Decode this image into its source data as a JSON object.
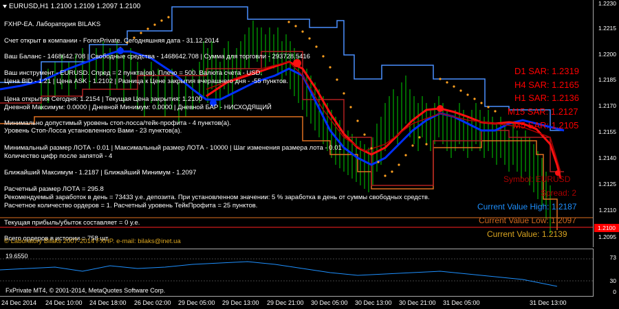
{
  "chart": {
    "header": "EURUSD,H1  1.2100 1.2109 1.2097 1.2100",
    "price_labels": [
      "1.2230",
      "1.2215",
      "1.2200",
      "1.2185",
      "1.2170",
      "1.2155",
      "1.2140",
      "1.2125",
      "1.2110",
      "1.2095"
    ],
    "current_price_box": "1.2100",
    "time_labels": [
      "24 Dec 2014",
      "24 Dec 10:00",
      "24 Dec 18:00",
      "26 Dec 02:00",
      "29 Dec 05:00",
      "29 Dec 13:00",
      "29 Dec 21:00",
      "30 Dec 05:00",
      "30 Dec 13:00",
      "30 Dec 21:00",
      "31 Dec 05:00",
      "31 Dec 13:00"
    ]
  },
  "info_lines": [
    "FXHP-EA. Лаборатория BILAKS",
    "Счет открыт в компании - ForexPrivate.    Сегодняшняя дата  -  31.12.2014",
    "Ваш Баланс - 1468642.708  |  Свободные средства - 1468642.708  |  Сумма для торговли - 293728.5416",
    "Ваш инструмент - EURUSD. Спред = 2 пункта(ов). Плечо = 500. Валюта счета - USD.",
    "Цена BID - 1.21  |  Цена ASK - 1.2102  |  Разница к Цене закрытия вчерашнего дня - -55 пунктов.",
    "Цена открытия Сегодня:  1.2154  |  Текущая Цена закрытия:  1.2100",
    "Дневной Максимум: 0.0000  |  Дневной Минимум: 0.0000  |  Дневной БАР - НИСХОДЯЩИЙ",
    "Минимально допустимый уровень стоп-лосса/тейк-профита - 4 пунктов(а).",
    "Уровень Стоп-Лосса установленного Вами - 23 пунктов(а).",
    "Минимальный размер ЛОТА - 0.01  |  Максимальный размер ЛОТА - 10000  |  Шаг изменения размера лота - 0.01",
    "Количество цифр после запятой - 4",
    "Ближайший Максимум - 1.2187  |  Ближайший Минимум - 1.2097",
    "Расчетный размер ЛОТА = 295.8",
    "Рекомендуемый заработок в день = 73433 у.е. депозита. При установленном значении: 5 % заработка в день от суммы свободных средств.",
    "Расчетное количество ордеров = 1. Расчетный уровень ТейкПрофита = 25 пунктов.",
    "Текущая прибыль/убыток составляет = 0 у.е.",
    "Всего ордеров в истории = 758 шт.",
    "© Laboratory Bilaks 2007-2014 FXHP. e-mail: bilaks@inet.ua"
  ],
  "sar": {
    "d1": "D1 SAR: 1.2319",
    "h4": "H4 SAR: 1.2165",
    "h1": "H1 SAR: 1.2136",
    "m15": "M15 SAR: 1.2127",
    "m5": "M5 SAR: 1.2105"
  },
  "right_labels": {
    "symbol": "Symbol: EURUSD",
    "spread": "Spread: 2",
    "current_high": "Current Value High: 1.2187",
    "current_low": "Current Value Low: 1.2097",
    "current_value": "Current Value: 1.2139"
  },
  "sub_chart": {
    "title": "19.6550",
    "levels": [
      "73",
      "30",
      "0"
    ]
  },
  "copyright": "FxPrivate MT4, © 2001-2014, MetaQuotes Software Corp.",
  "colors": {
    "sar_text": "#ff0000",
    "high_text": "#1e90ff",
    "low_text": "#d2691e",
    "current_text": "#daa520"
  }
}
